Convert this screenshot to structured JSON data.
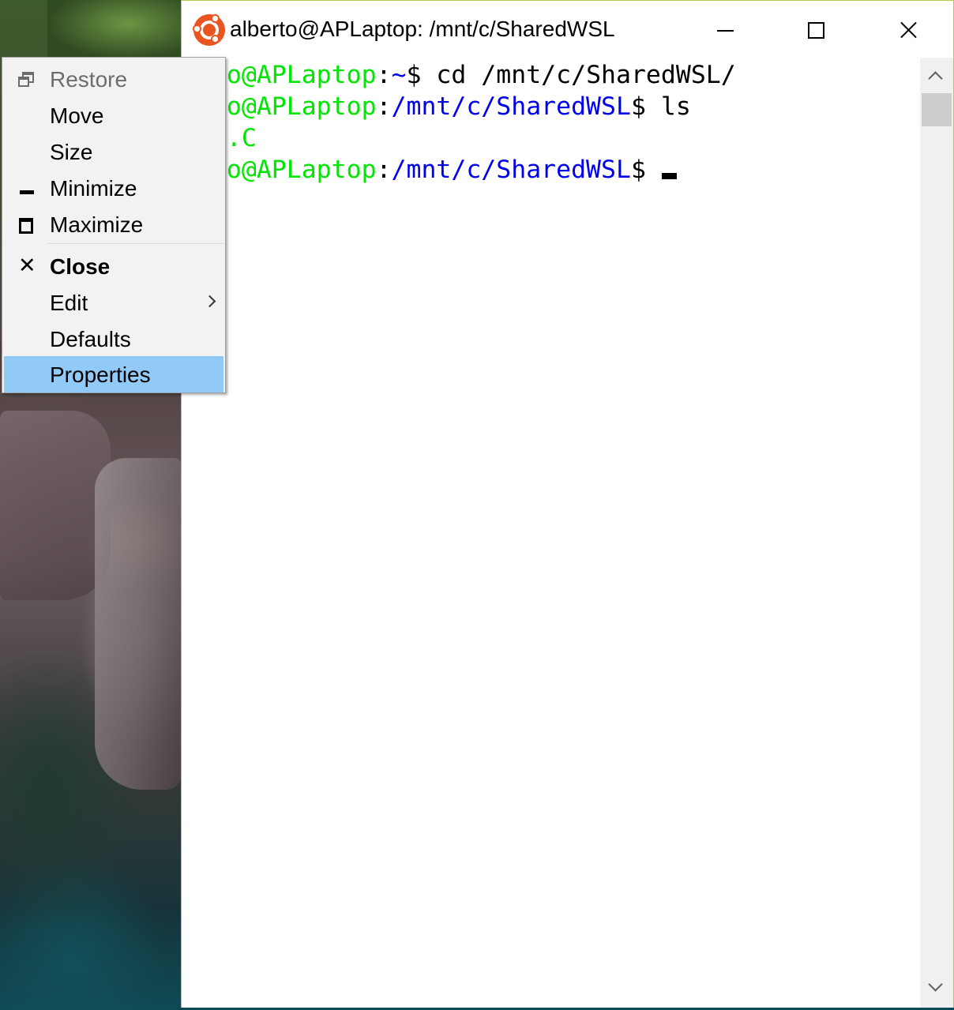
{
  "window": {
    "title": "alberto@APLaptop: /mnt/c/SharedWSL",
    "accent_color": "#b6c94a",
    "app_icon": "ubuntu-icon",
    "controls": [
      "minimize-icon",
      "maximize-icon",
      "close-icon"
    ]
  },
  "terminal": {
    "lines": [
      {
        "user": "erto@APLaptop",
        "sep": ":",
        "path": "~",
        "prompt": "$",
        "command": " cd /mnt/c/SharedWSL/"
      },
      {
        "user": "erto@APLaptop",
        "sep": ":",
        "path": "/mnt/c/SharedWSL",
        "prompt": "$",
        "command": " ls"
      },
      {
        "output": "ode.C"
      },
      {
        "user": "erto@APLaptop",
        "sep": ":",
        "path": "/mnt/c/SharedWSL",
        "prompt": "$",
        "command": ""
      }
    ],
    "colors": {
      "user": "#00e600",
      "path": "#0000ee",
      "text": "#000000"
    }
  },
  "system_menu": {
    "items": [
      {
        "label": "Restore",
        "icon": "restore-icon",
        "enabled": false
      },
      {
        "label": "Move",
        "enabled": true
      },
      {
        "label": "Size",
        "enabled": true
      },
      {
        "label": "Minimize",
        "icon": "minimize-icon",
        "enabled": true
      },
      {
        "label": "Maximize",
        "icon": "maximize-icon",
        "enabled": true
      },
      {
        "label": "Close",
        "icon": "close-icon",
        "bold": true,
        "enabled": true
      },
      {
        "label": "Edit",
        "submenu": true,
        "enabled": true
      },
      {
        "label": "Defaults",
        "enabled": true
      },
      {
        "label": "Properties",
        "highlighted": true,
        "enabled": true
      }
    ],
    "highlight_color": "#91c9f7"
  }
}
